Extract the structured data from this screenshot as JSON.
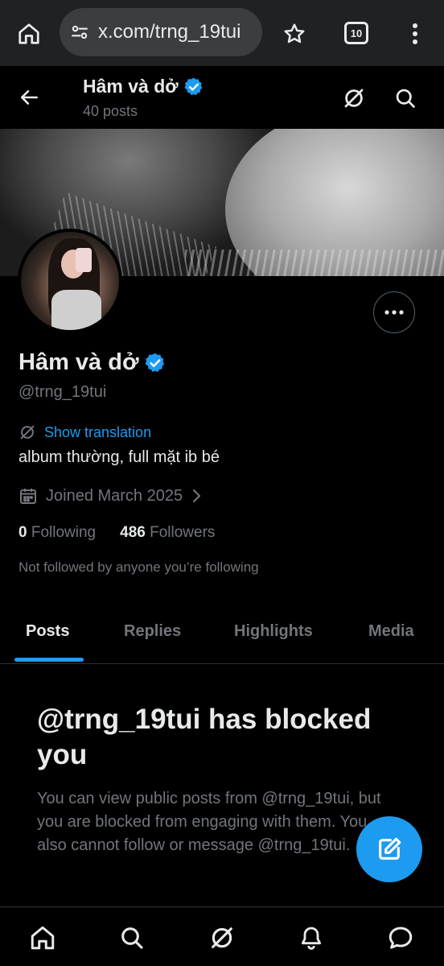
{
  "browser": {
    "url": "x.com/trng_19tui",
    "tab_count": "10"
  },
  "header": {
    "title": "Hâm và dở",
    "post_count": "40 posts"
  },
  "profile": {
    "name": "Hâm và dở",
    "handle": "@trng_19tui",
    "translate_label": "Show translation",
    "bio": "album thường, full mặt ib bé",
    "joined": "Joined March 2025",
    "following_count": "0",
    "following_label": "Following",
    "followers_count": "486",
    "followers_label": "Followers",
    "not_followed": "Not followed by anyone you’re following"
  },
  "tabs": [
    {
      "label": "Posts",
      "active": true
    },
    {
      "label": "Replies",
      "active": false
    },
    {
      "label": "Highlights",
      "active": false
    },
    {
      "label": "Media",
      "active": false
    }
  ],
  "blocked": {
    "title": "@trng_19tui has blocked you",
    "description": "You can view public posts from @trng_19tui, but you are blocked from engaging with them. You also cannot follow or message @trng_19tui."
  },
  "colors": {
    "accent": "#1d9bf0",
    "background": "#000000",
    "muted_text": "#71767b"
  },
  "icons": [
    "home-icon",
    "tune-icon",
    "star-icon",
    "tabs-icon",
    "more-vert-icon",
    "back-arrow-icon",
    "grok-icon",
    "search-icon",
    "verified-badge-icon",
    "more-horizontal-icon",
    "translate-icon",
    "calendar-icon",
    "chevron-right-icon",
    "compose-icon",
    "bell-icon",
    "messages-icon"
  ]
}
